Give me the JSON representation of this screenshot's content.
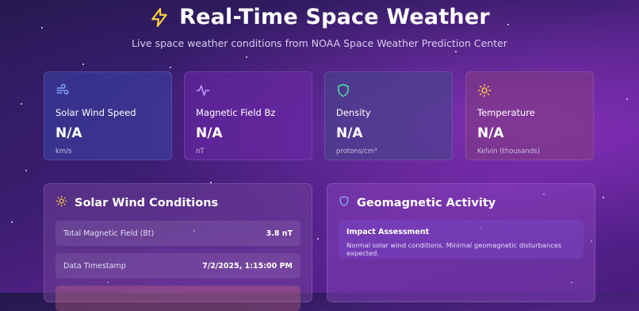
{
  "header": {
    "title": "Real-Time Space Weather",
    "subtitle": "Live space weather conditions from NOAA Space Weather Prediction Center"
  },
  "stats": [
    {
      "label": "Solar Wind Speed",
      "value": "N/A",
      "unit": "km/s",
      "icon": "wind-icon",
      "accent": "#7fa8ff"
    },
    {
      "label": "Magnetic Field Bz",
      "value": "N/A",
      "unit": "nT",
      "icon": "activity-icon",
      "accent": "#c79bff"
    },
    {
      "label": "Density",
      "value": "N/A",
      "unit": "protons/cm³",
      "icon": "shield-icon",
      "accent": "#4fe0a0"
    },
    {
      "label": "Temperature",
      "value": "N/A",
      "unit": "Kelvin (thousands)",
      "icon": "sun-icon",
      "accent": "#ffc24a"
    }
  ],
  "solar_wind": {
    "title": "Solar Wind Conditions",
    "rows": [
      {
        "label": "Total Magnetic Field (Bt)",
        "value": "3.8 nT"
      },
      {
        "label": "Data Timestamp",
        "value": "7/2/2025, 1:15:00 PM"
      }
    ]
  },
  "geomagnetic": {
    "title": "Geomagnetic Activity",
    "impact_title": "Impact Assessment",
    "impact_text": "Normal solar wind conditions. Minimal geomagnetic disturbances expected."
  },
  "colors": {
    "lightning": "#ffd23a",
    "sun": "#ffc24a",
    "shield_blue": "#8ab4ff"
  }
}
